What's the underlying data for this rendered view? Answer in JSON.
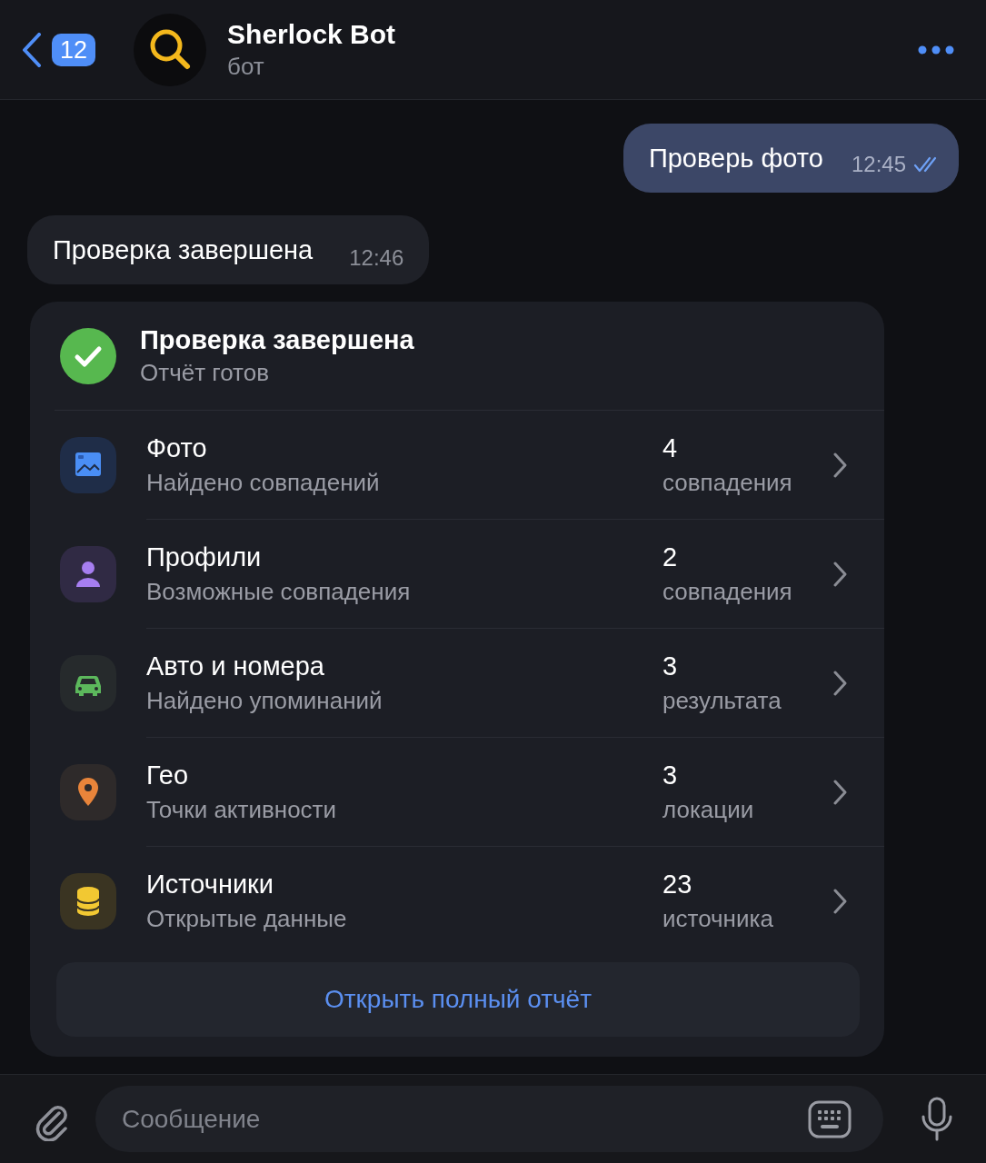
{
  "header": {
    "unread_count": "12",
    "title": "Sherlock Bot",
    "subtitle": "бот"
  },
  "messages": [
    {
      "kind": "outgoing",
      "text": "Проверь фото",
      "time": "12:45",
      "read": true
    },
    {
      "kind": "incoming",
      "text": "Проверка завершена",
      "time": "12:46"
    }
  ],
  "report_card": {
    "title": "Проверка завершена",
    "subtitle": "Отчёт готов",
    "rows": [
      {
        "kind": "photo",
        "title": "Фото",
        "subtitle": "Найдено совпадений",
        "count": "4",
        "unit": "совпадения"
      },
      {
        "kind": "profiles",
        "title": "Профили",
        "subtitle": "Возможные совпадения",
        "count": "2",
        "unit": "совпадения"
      },
      {
        "kind": "car",
        "title": "Авто и номера",
        "subtitle": "Найдено упоминаний",
        "count": "3",
        "unit": "результата"
      },
      {
        "kind": "geo",
        "title": "Гео",
        "subtitle": "Точки активности",
        "count": "3",
        "unit": "локации"
      },
      {
        "kind": "sources",
        "title": "Источники",
        "subtitle": "Открытые данные",
        "count": "23",
        "unit": "источника"
      }
    ],
    "button": "Открыть полный отчёт"
  },
  "composer": {
    "placeholder": "Сообщение"
  }
}
